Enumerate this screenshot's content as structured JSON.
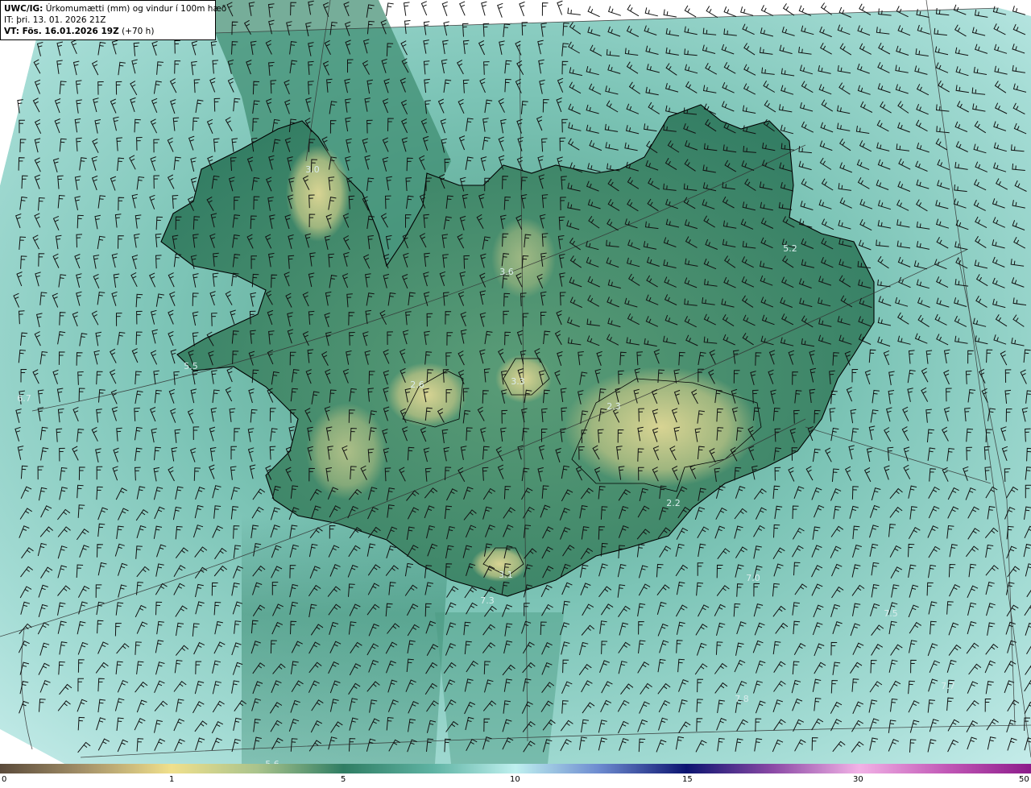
{
  "header": {
    "line1_bold": "UWC/IG:",
    "line1_rest": " Úrkomumætti (mm) og vindur í 100m hæð",
    "line2": "IT: þri. 13. 01. 2026 21Z",
    "line3_bold": "VT: Fös. 16.01.2026 19Z",
    "line3_rest": " (+70 h)"
  },
  "value_labels": [
    {
      "text": "3.0"
    },
    {
      "text": "3.6"
    },
    {
      "text": "5.2"
    },
    {
      "text": "5.5"
    },
    {
      "text": "2.6"
    },
    {
      "text": "3.3"
    },
    {
      "text": "2.3"
    },
    {
      "text": "2.2"
    },
    {
      "text": "3.1"
    },
    {
      "text": "7.3"
    },
    {
      "text": "7.5"
    },
    {
      "text": "7.7"
    },
    {
      "text": "7.8"
    },
    {
      "text": "7.0"
    },
    {
      "text": "5.6"
    },
    {
      "text": "6.7"
    }
  ],
  "colorbar": {
    "ticks": [
      "0",
      "1",
      "5",
      "10",
      "15",
      "30",
      "50"
    ]
  },
  "colors": {
    "land_low": "#c9cc8c",
    "land_mid": "#3f8f72",
    "sea": "#8fd1c9",
    "sea_light": "#b8e8e4",
    "coast": "#000000"
  },
  "icons": {
    "wind": "wind-barb-icon"
  }
}
